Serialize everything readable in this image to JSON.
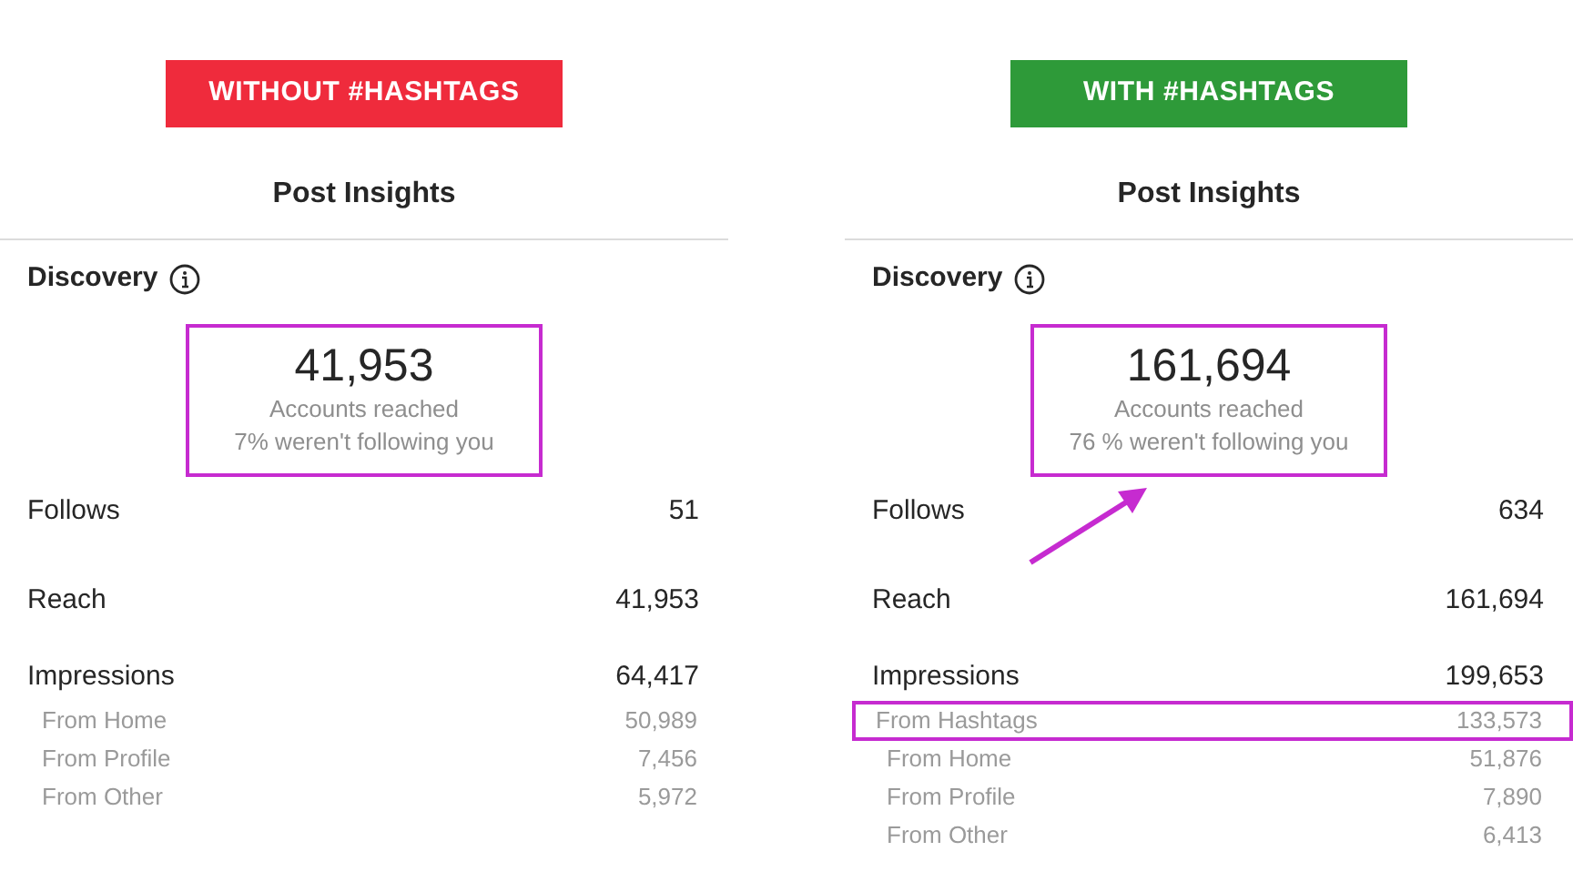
{
  "panels": [
    {
      "banner": {
        "text": "WITHOUT #HASHTAGS",
        "color": "#ef2b3c"
      },
      "title": "Post Insights",
      "section": "Discovery",
      "summary": {
        "value": "41,953",
        "label": "Accounts reached",
        "note": "7% weren't following you",
        "highlighted": true
      },
      "arrow": false,
      "metrics": [
        {
          "label": "Follows",
          "value": "51"
        },
        {
          "label": "Reach",
          "value": "41,953"
        },
        {
          "label": "Impressions",
          "value": "64,417"
        }
      ],
      "sources": [
        {
          "label": "From Home",
          "value": "50,989",
          "highlighted": false
        },
        {
          "label": "From Profile",
          "value": "7,456",
          "highlighted": false
        },
        {
          "label": "From Other",
          "value": "5,972",
          "highlighted": false
        }
      ]
    },
    {
      "banner": {
        "text": "WITH #HASHTAGS",
        "color": "#2e9a39"
      },
      "title": "Post Insights",
      "section": "Discovery",
      "summary": {
        "value": "161,694",
        "label": "Accounts reached",
        "note": "76 % weren't following you",
        "highlighted": true
      },
      "arrow": true,
      "metrics": [
        {
          "label": "Follows",
          "value": "634"
        },
        {
          "label": "Reach",
          "value": "161,694"
        },
        {
          "label": "Impressions",
          "value": "199,653"
        }
      ],
      "sources": [
        {
          "label": "From Hashtags",
          "value": "133,573",
          "highlighted": true
        },
        {
          "label": "From Home",
          "value": "51,876",
          "highlighted": false
        },
        {
          "label": "From Profile",
          "value": "7,890",
          "highlighted": false
        },
        {
          "label": "From Other",
          "value": "6,413",
          "highlighted": false
        }
      ]
    }
  ]
}
